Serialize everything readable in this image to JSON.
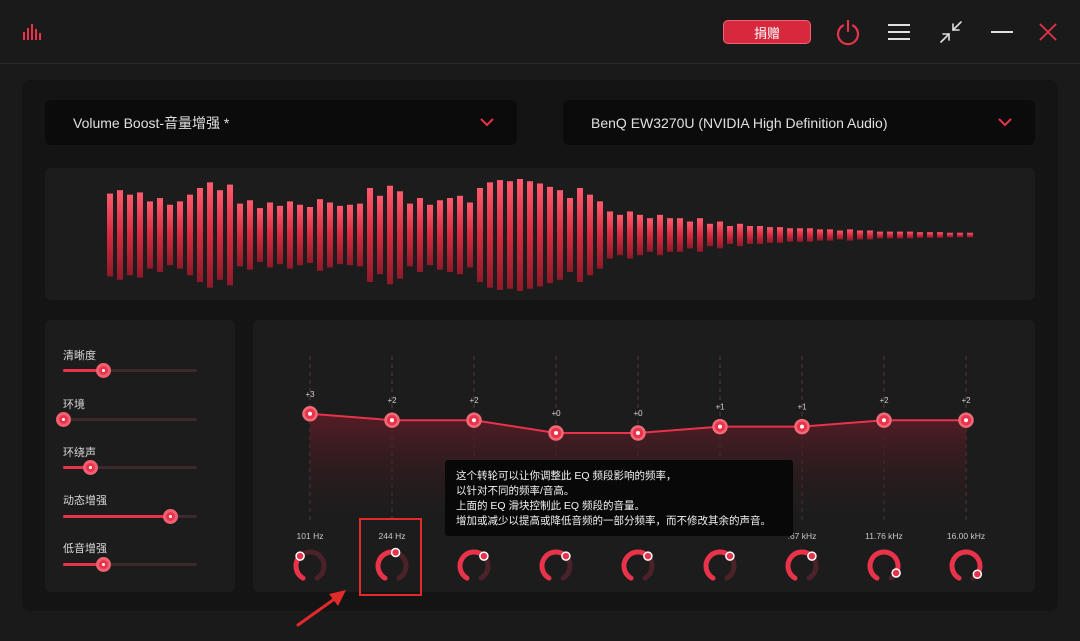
{
  "titlebar": {
    "logo_icon": "equalizer-bars-icon",
    "donate_label": "捐赠",
    "icons": [
      "power-icon",
      "menu-icon",
      "shrink-icon",
      "minimize-icon",
      "close-icon"
    ]
  },
  "preset_dropdown": {
    "value": "Volume Boost-音量增强 *",
    "icon": "chevron-down-icon"
  },
  "device_dropdown": {
    "value": "BenQ EW3270U (NVIDIA High Definition Audio)",
    "icon": "chevron-down-icon"
  },
  "waveform": {
    "levels": [
      0.74,
      0.8,
      0.72,
      0.76,
      0.6,
      0.66,
      0.54,
      0.6,
      0.72,
      0.84,
      0.94,
      0.8,
      0.9,
      0.56,
      0.62,
      0.48,
      0.58,
      0.52,
      0.6,
      0.54,
      0.5,
      0.64,
      0.58,
      0.52,
      0.54,
      0.56,
      0.84,
      0.7,
      0.88,
      0.78,
      0.56,
      0.66,
      0.54,
      0.62,
      0.66,
      0.7,
      0.58,
      0.84,
      0.94,
      0.98,
      0.96,
      1.0,
      0.96,
      0.92,
      0.86,
      0.8,
      0.66,
      0.84,
      0.72,
      0.6,
      0.42,
      0.36,
      0.42,
      0.36,
      0.3,
      0.36,
      0.3,
      0.3,
      0.24,
      0.3,
      0.2,
      0.24,
      0.16,
      0.2,
      0.16,
      0.16,
      0.14,
      0.14,
      0.12,
      0.12,
      0.12,
      0.1,
      0.1,
      0.08,
      0.1,
      0.08,
      0.08,
      0.06,
      0.06,
      0.06,
      0.06,
      0.05,
      0.05,
      0.05,
      0.04,
      0.04,
      0.04
    ],
    "color": "#e8334a"
  },
  "sliders": [
    {
      "label": "清晰度",
      "value": 0.3
    },
    {
      "label": "环境",
      "value": 0.0
    },
    {
      "label": "环绕声",
      "value": 0.2
    },
    {
      "label": "动态增强",
      "value": 0.8
    },
    {
      "label": "低音增强",
      "value": 0.3
    }
  ],
  "eq": {
    "bands": [
      {
        "gain": "+3",
        "value": 3,
        "freq": "101 Hz",
        "dial": 0.35
      },
      {
        "gain": "+2",
        "value": 2,
        "freq": "244 Hz",
        "dial": 0.55
      },
      {
        "gain": "+2",
        "value": 2,
        "freq": "",
        "dial": 0.65
      },
      {
        "gain": "+0",
        "value": 0,
        "freq": "",
        "dial": 0.65
      },
      {
        "gain": "+0",
        "value": 0,
        "freq": "",
        "dial": 0.65
      },
      {
        "gain": "+1",
        "value": 1,
        "freq": "",
        "dial": 0.65
      },
      {
        "gain": "+1",
        "value": 1,
        "freq": ".67 kHz",
        "dial": 0.65
      },
      {
        "gain": "+2",
        "value": 2,
        "freq": "11.76 kHz",
        "dial": 0.9
      },
      {
        "gain": "+2",
        "value": 2,
        "freq": "16.00 kHz",
        "dial": 0.92
      }
    ]
  },
  "tooltip": {
    "lines": [
      "这个转轮可以让你调整此 EQ 频段影响的频率，",
      "以针对不同的频率/音高。",
      "上面的 EQ 滑块控制此 EQ 频段的音量。",
      "增加或减少以提高或降低音频的一部分频率，而不修改其余的声音。"
    ]
  },
  "annotation": {
    "arrow_icon": "red-arrow-icon",
    "highlight_color": "#e22a2a"
  },
  "colors": {
    "accent": "#e8334a",
    "background": "#1a1a1a",
    "panel": "#141414"
  }
}
